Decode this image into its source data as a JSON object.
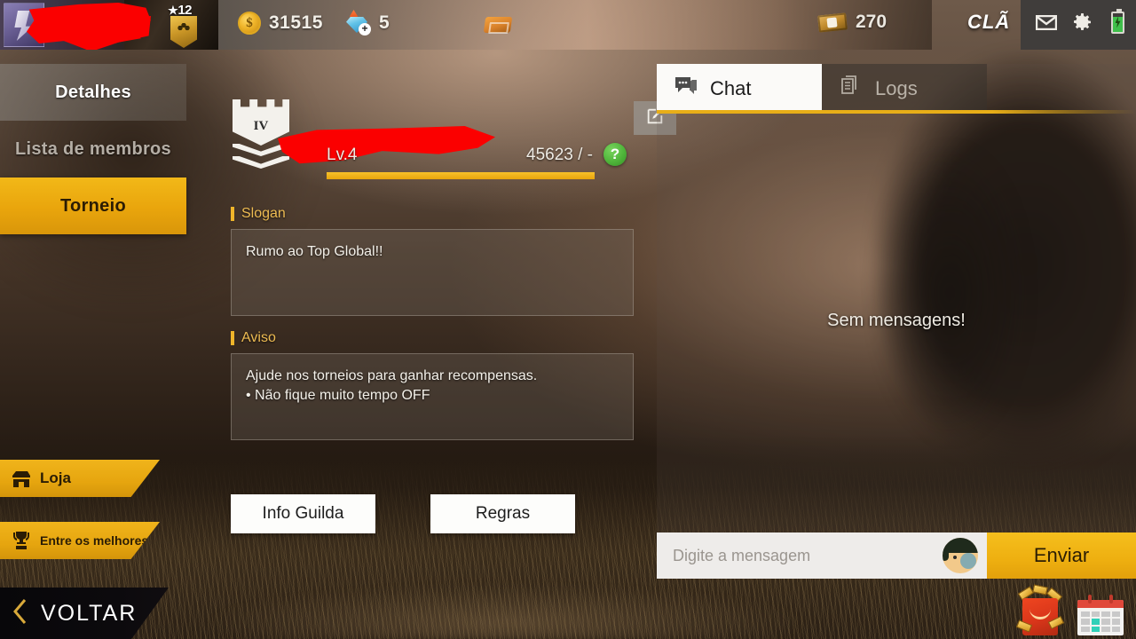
{
  "topbar": {
    "player": {
      "level_badge": "12",
      "star_icon": "star-icon",
      "name_redacted": ""
    },
    "currencies": [
      {
        "icon": "coin-icon",
        "value": "31515"
      },
      {
        "icon": "diamond-icon",
        "value": "5"
      }
    ],
    "card_icon": "card-icon",
    "tickets": {
      "icon": "ticket-icon",
      "value": "270"
    },
    "clan_label": "CLÃ",
    "icons": [
      "mail-icon",
      "gear-icon",
      "battery-icon"
    ]
  },
  "sidebar": {
    "items": [
      {
        "label": "Detalhes",
        "state": "header"
      },
      {
        "label": "Lista de membros",
        "state": "normal"
      },
      {
        "label": "Torneio",
        "state": "active"
      }
    ],
    "banners": [
      {
        "label": "Loja",
        "icon": "shop-icon"
      },
      {
        "label": "Entre os melhores",
        "icon": "trophy-icon"
      }
    ]
  },
  "guild": {
    "emblem_rank": "IV",
    "name_redacted": "",
    "level": "Lv.4",
    "xp": "45623 / -",
    "xp_percent": 100,
    "help_glyph": "?",
    "edit_icon": "edit-pencil-icon",
    "slogan": {
      "label": "Slogan",
      "text": "Rumo ao Top Global!!"
    },
    "notice": {
      "label": "Aviso",
      "line1": "Ajude nos torneios para ganhar recompensas.",
      "line2": "• Não fique muito tempo OFF"
    },
    "buttons": [
      {
        "label": "Info Guilda"
      },
      {
        "label": "Regras"
      }
    ]
  },
  "chat": {
    "tabs": [
      {
        "label": "Chat",
        "icon": "speech-bubble-icon",
        "active": true
      },
      {
        "label": "Logs",
        "icon": "document-icon",
        "active": false
      }
    ],
    "empty_message": "Sem mensagens!",
    "input_placeholder": "Digite a mensagem",
    "emoji_button": "emoji-avatar-icon",
    "send_label": "Enviar"
  },
  "bottom": {
    "back_label": "VOLTAR",
    "back_icon": "chevron-left-icon",
    "shortcuts": [
      {
        "icon": "shop-bag-icon"
      },
      {
        "icon": "calendar-icon"
      }
    ]
  },
  "colors": {
    "accent_gold": "#eeaf10",
    "panel_white": "#fbfaf8",
    "help_green": "#4fb53a",
    "redact_red": "#fb0000"
  }
}
